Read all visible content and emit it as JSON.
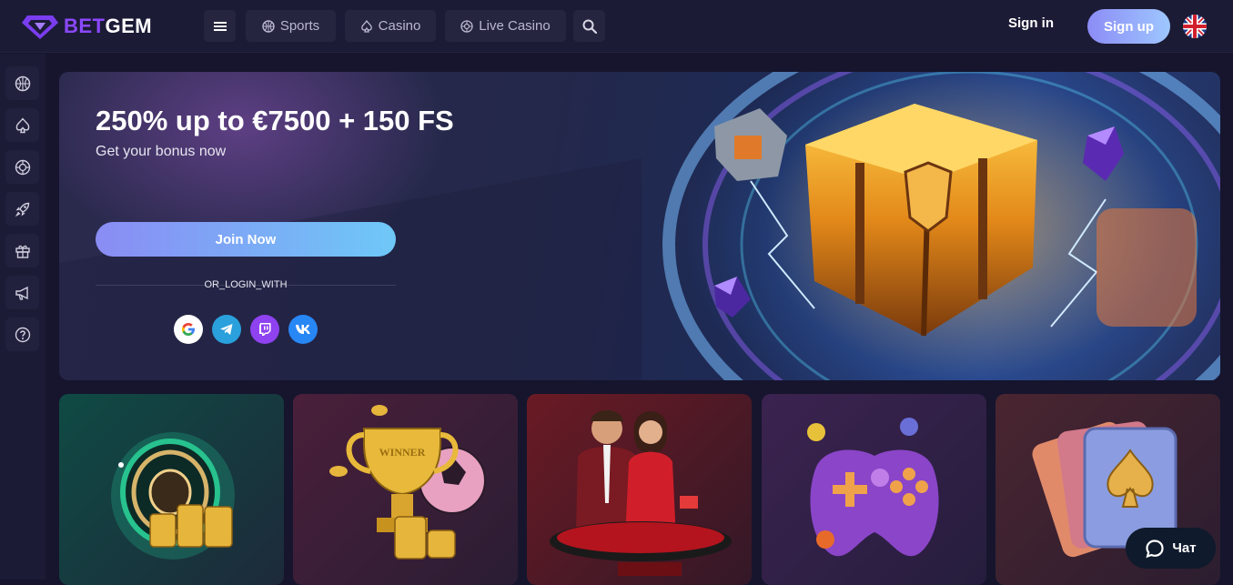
{
  "header": {
    "logo_text_a": "BET",
    "logo_text_b": "GEM",
    "nav": [
      {
        "label": "Sports",
        "icon": "basketball-icon"
      },
      {
        "label": "Casino",
        "icon": "spade-icon"
      },
      {
        "label": "Live Casino",
        "icon": "roulette-icon"
      }
    ],
    "sign_in": "Sign in",
    "sign_up": "Sign up"
  },
  "sidebar": {
    "items": [
      "basketball-icon",
      "spade-icon",
      "roulette-icon",
      "rocket-icon",
      "gift-icon",
      "megaphone-icon",
      "help-icon"
    ]
  },
  "banner": {
    "title": "250% up to €7500 + 150 FS",
    "subtitle": "Get your bonus now",
    "join_label": "Join Now",
    "or_login_with": "OR_LOGIN_WITH",
    "socials": [
      {
        "name": "google",
        "glyph": "G",
        "color": "#ffffff"
      },
      {
        "name": "telegram",
        "glyph": "➤",
        "color": "#2aa0dc"
      },
      {
        "name": "twitch",
        "glyph": "▣",
        "color": "#8f42f0"
      },
      {
        "name": "vk",
        "glyph": "VK",
        "color": "#2787f5"
      }
    ]
  },
  "tiles": [
    {
      "name": "roulette",
      "colors": [
        "#0f4a44",
        "#1d2a3a"
      ]
    },
    {
      "name": "sports-trophy",
      "colors": [
        "#4a1f3a",
        "#2a1d34"
      ],
      "trophy_text": "WINNER"
    },
    {
      "name": "live-dealers",
      "colors": [
        "#6a1a24",
        "#331827"
      ]
    },
    {
      "name": "gamepad",
      "colors": [
        "#3b2350",
        "#261d3d"
      ]
    },
    {
      "name": "cards",
      "colors": [
        "#4a2530",
        "#2b1d30"
      ]
    }
  ],
  "chat": {
    "label": "Чат"
  },
  "colors": {
    "accent": "#8b48ff",
    "bg": "#16152d",
    "panel": "#1c1b36"
  }
}
